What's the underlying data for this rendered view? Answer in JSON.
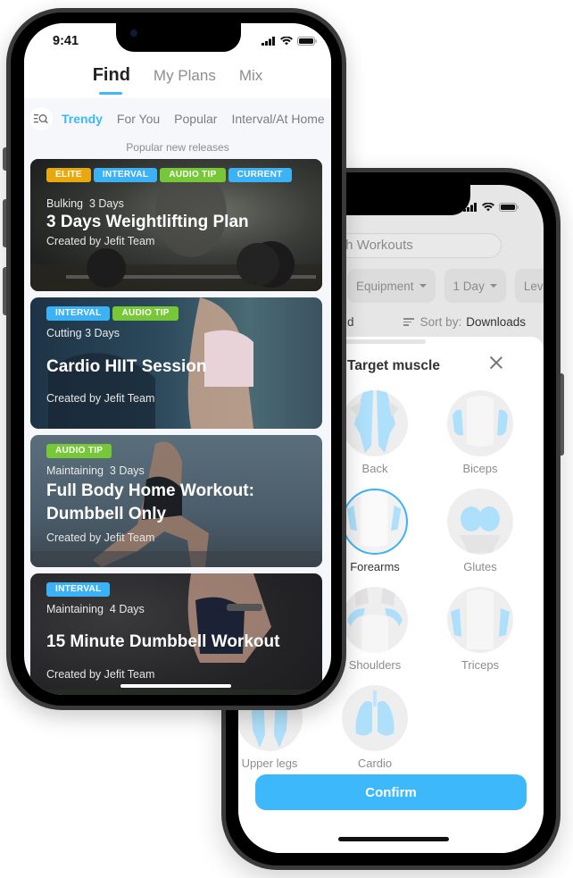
{
  "back_phone": {
    "search": {
      "placeholder": "Search Workouts",
      "visible_text": "earch Workouts"
    },
    "filters": [
      {
        "label": ""
      },
      {
        "label": "Equipment"
      },
      {
        "label": "1 Day"
      },
      {
        "label": "Lev"
      }
    ],
    "result_label_partial": "d",
    "sort": {
      "label": "Sort by:",
      "value": "Downloads"
    },
    "sheet": {
      "title": "Target muscle",
      "title_visible": "Target muscle",
      "muscles": [
        {
          "label": "Back",
          "selected": false
        },
        {
          "label": "Biceps",
          "selected": false
        },
        {
          "label": "Forearms",
          "selected": true
        },
        {
          "label": "Glutes",
          "selected": false
        },
        {
          "label": "Shoulders",
          "selected": false
        },
        {
          "label": "Triceps",
          "selected": false
        },
        {
          "label": "Upper legs",
          "selected": false
        },
        {
          "label": "Cardio",
          "selected": false
        }
      ],
      "confirm_label": "Confirm"
    }
  },
  "front_phone": {
    "status_time": "9:41",
    "top_tabs": [
      {
        "label": "Find",
        "active": true
      },
      {
        "label": "My Plans",
        "active": false
      },
      {
        "label": "Mix",
        "active": false
      }
    ],
    "sub_tabs": [
      {
        "label": "Trendy",
        "active": true
      },
      {
        "label": "For You",
        "active": false
      },
      {
        "label": "Popular",
        "active": false
      },
      {
        "label": "Interval/At Home",
        "active": false
      }
    ],
    "section_label": "Popular new releases",
    "cards": [
      {
        "tags": [
          {
            "label": "ELITE",
            "color": "#e9a90e"
          },
          {
            "label": "INTERVAL",
            "color": "#3cb2f6"
          },
          {
            "label": "AUDIO TIP",
            "color": "#77c836"
          },
          {
            "label": "CURRENT",
            "color": "#3cb2f6"
          }
        ],
        "goal": "Bulking",
        "days": "3 Days",
        "title": "3 Days Weightlifting Plan",
        "creator": "Created by Jefit Team"
      },
      {
        "tags": [
          {
            "label": "INTERVAL",
            "color": "#3cb2f6"
          },
          {
            "label": "AUDIO TIP",
            "color": "#77c836"
          }
        ],
        "goal": "Cutting",
        "days": "3 Days",
        "title": "Cardio HIIT Session",
        "creator": "Created by Jefit Team"
      },
      {
        "tags": [
          {
            "label": "AUDIO TIP",
            "color": "#77c836"
          }
        ],
        "goal": "Maintaining",
        "days": "3 Days",
        "title": "Full Body Home Workout: Dumbbell Only",
        "title_line1": "Full Body Home Workout:",
        "title_line2": "Dumbbell Only",
        "creator": "Created by Jefit Team"
      },
      {
        "tags": [
          {
            "label": "INTERVAL",
            "color": "#3cb2f6"
          }
        ],
        "goal": "Maintaining",
        "days": "4 Days",
        "title": "15 Minute Dumbbell Workout",
        "creator": "Created by Jefit Team"
      }
    ]
  },
  "colors": {
    "accent": "#3cb8fb",
    "tag_elite": "#e9a90e",
    "tag_interval": "#3cb2f6",
    "tag_audio": "#77c836",
    "muscle_highlight": "#aee0fb"
  }
}
